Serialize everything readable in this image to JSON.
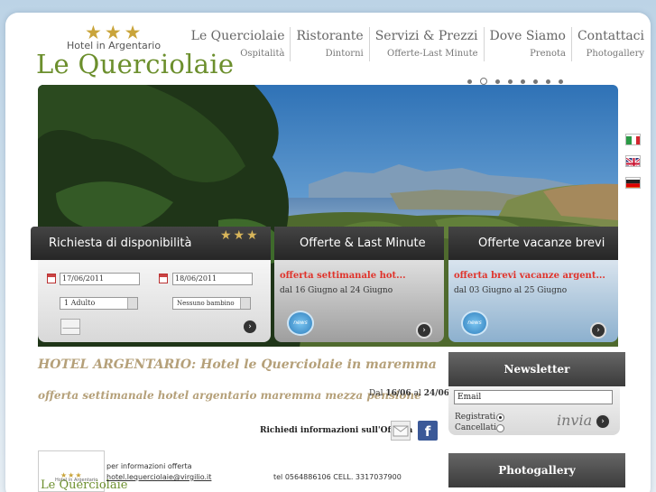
{
  "brand": {
    "stars": "★★★",
    "subtitle": "Hotel in Argentario",
    "name": "Le Querciolaie"
  },
  "nav": [
    {
      "main": "Le Querciolaie",
      "sub": "Ospitalità"
    },
    {
      "main": "Ristorante",
      "sub": "Dintorni"
    },
    {
      "main": "Servizi & Prezzi",
      "sub": "Offerte-Last Minute"
    },
    {
      "main": "Dove Siamo",
      "sub": "Prenota"
    },
    {
      "main": "Contattaci",
      "sub": "Photogallery"
    }
  ],
  "slideshow": {
    "count": 8,
    "active_index": 1
  },
  "languages": [
    "italian-flag-icon",
    "english-flag-icon",
    "german-flag-icon"
  ],
  "availability": {
    "title": "Richiesta di disponibilità",
    "stars": "★★★",
    "checkin": "17/06/2011",
    "checkout": "18/06/2011",
    "adults": "1 Adulto",
    "children": "Nessuno bambino"
  },
  "offers": {
    "title": "Offerte & Last Minute",
    "item_title": "offerta settimanale hot...",
    "item_dates": "dal 16 Giugno al 24 Giugno",
    "badge": "news"
  },
  "short_offers": {
    "title": "Offerte vacanze brevi",
    "item_title": "offerta brevi vacanze argent...",
    "item_dates": "dal 03 Giugno al 25 Giugno",
    "badge": "news"
  },
  "content": {
    "heading": "HOTEL ARGENTARIO: Hotel le Querciolaie in maremma",
    "offer_heading": "offerta settimanale hotel argentario maremma mezza pensione",
    "date_prefix": "Dal",
    "date_from": "16/06",
    "date_sep": "al",
    "date_to": "24/06",
    "request_info": "Richiedi informazioni sull'Offerta",
    "info_label": "per informazioni offerta",
    "email": "hotel.lequerciolaie@virgilio.it",
    "phone": "tel 0564886106 CELL. 3317037900",
    "thumb_stars": "★★★",
    "thumb_sub": "Hotel in Argentario",
    "thumb_name": "Le Querciolaie"
  },
  "newsletter": {
    "title": "Newsletter",
    "email_placeholder": "Email",
    "subscribe_label": "Registrati",
    "unsubscribe_label": "Cancellati",
    "selected": "Registrati",
    "submit_label": "invia"
  },
  "photogallery": {
    "title": "Photogallery"
  },
  "colors": {
    "accent_green": "#6c8f2d",
    "gold": "#c9a43a",
    "offer_red": "#e0332b",
    "heading_tan": "#b5a079"
  }
}
